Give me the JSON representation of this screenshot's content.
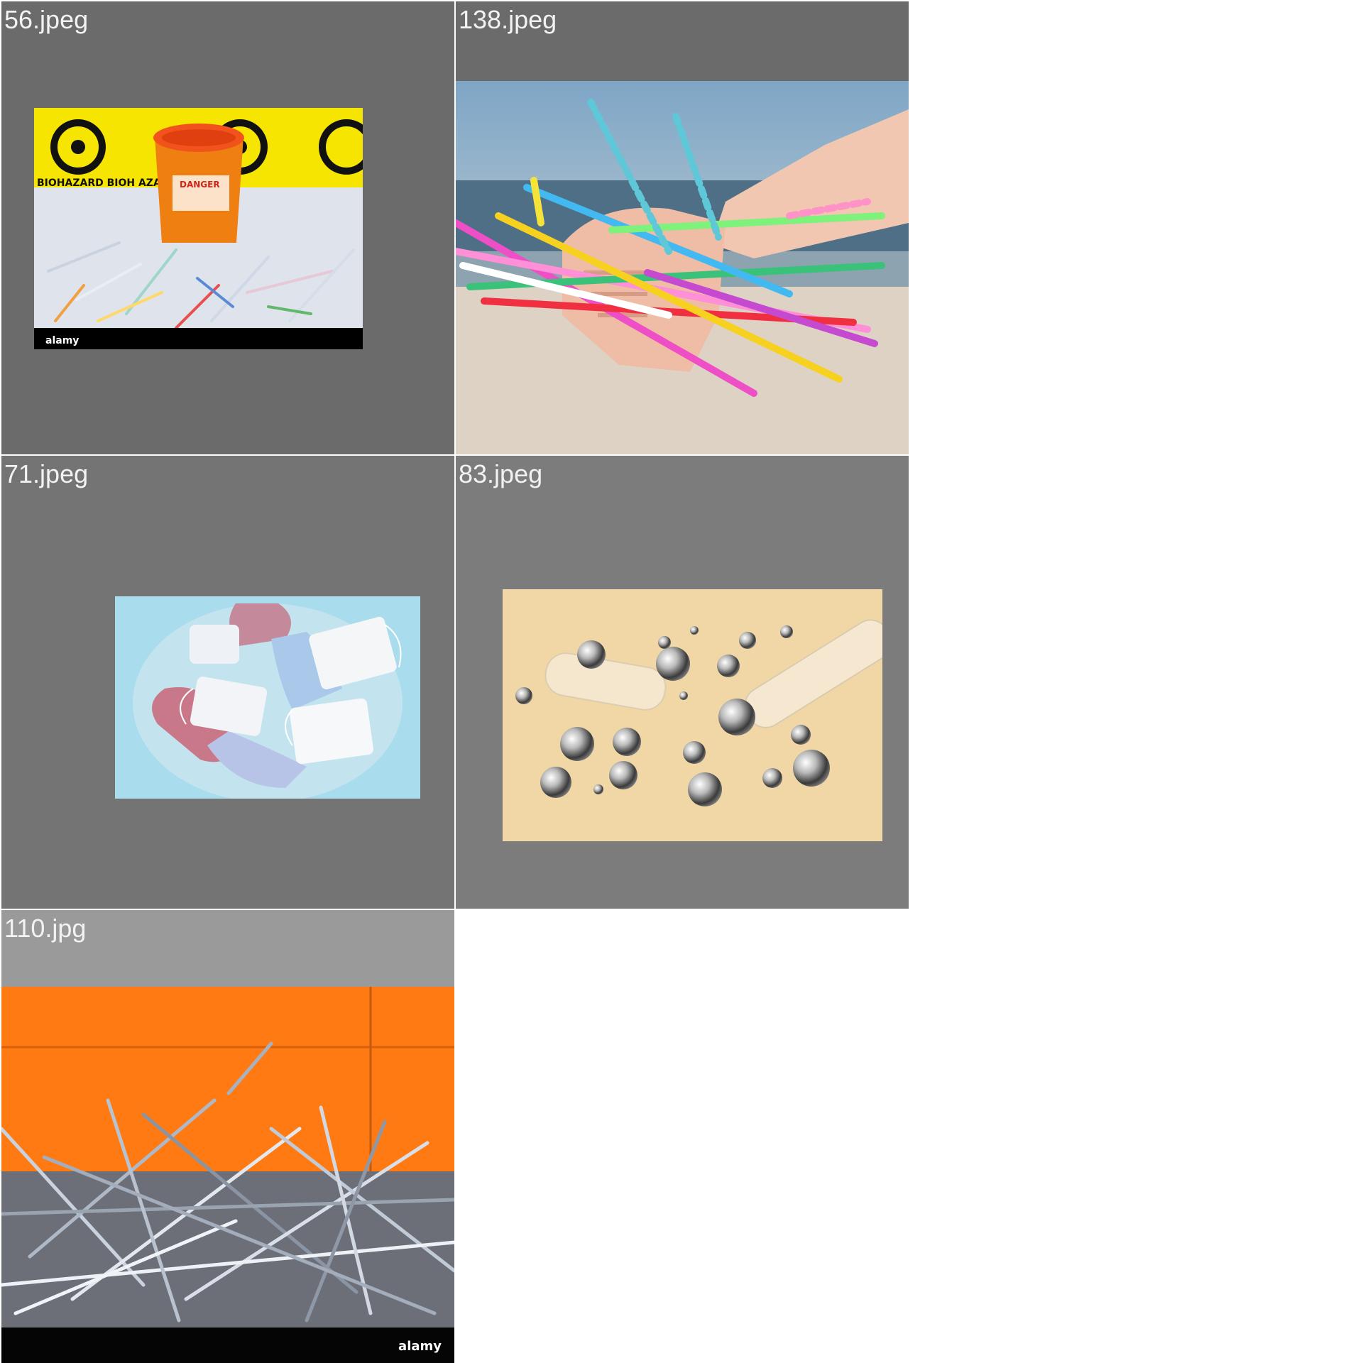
{
  "gallery": {
    "tiles": [
      {
        "label": "56.jpeg",
        "thumbnail": "biohazard-sharps-container-photo",
        "watermark": "alamy"
      },
      {
        "label": "138.jpeg",
        "thumbnail": "hand-holding-plastic-straws-photo"
      },
      {
        "label": "71.jpeg",
        "thumbnail": "used-gloves-and-masks-in-bag-photo"
      },
      {
        "label": "83.jpeg",
        "thumbnail": "mercury-droplets-and-test-tube-photo"
      },
      {
        "label": "110.jpg",
        "thumbnail": "scrap-metal-pile-photo",
        "watermark": "alamy"
      }
    ]
  },
  "colors": {
    "page_background": "#ffffff",
    "tile_background_dark": "#6b6b6b",
    "tile_background_light": "#9a9a9a",
    "label_text": "#f2f2f2"
  }
}
